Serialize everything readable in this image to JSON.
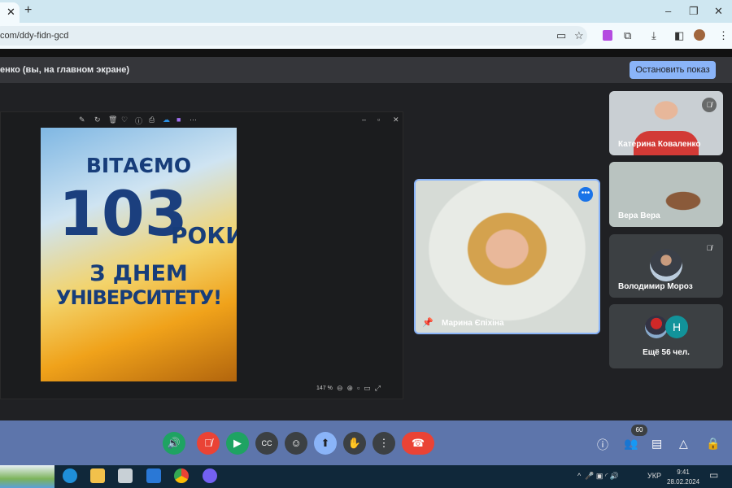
{
  "browser": {
    "tab_close": "✕",
    "new_tab": "+",
    "url": "com/ddy-fidn-gcd",
    "win_min": "–",
    "win_max": "❐",
    "win_close": "✕"
  },
  "banner": {
    "text": "енко (вы, на главном экране)",
    "stop_button": "Остановить показ"
  },
  "shared": {
    "poster_line1": "ВІТАЄМО",
    "poster_number": "103",
    "poster_roky": "РОКИ",
    "poster_line3": "З ДНЕМ",
    "poster_line4": "УНІВЕРСИТЕТУ!",
    "zoom": "147 %"
  },
  "center": {
    "name": "Марина Єпіхіна"
  },
  "tiles": [
    {
      "name": "Катерина Коваленко"
    },
    {
      "name": "Вера Вера"
    },
    {
      "name": "Володимир Мороз"
    },
    {
      "name": "Ещё 56 чел.",
      "avatar_letter": "Н"
    }
  ],
  "controls": {
    "participants_count": "60"
  },
  "taskbar": {
    "lang": "УКР",
    "time": "9:41",
    "date": "28.02.2024"
  }
}
